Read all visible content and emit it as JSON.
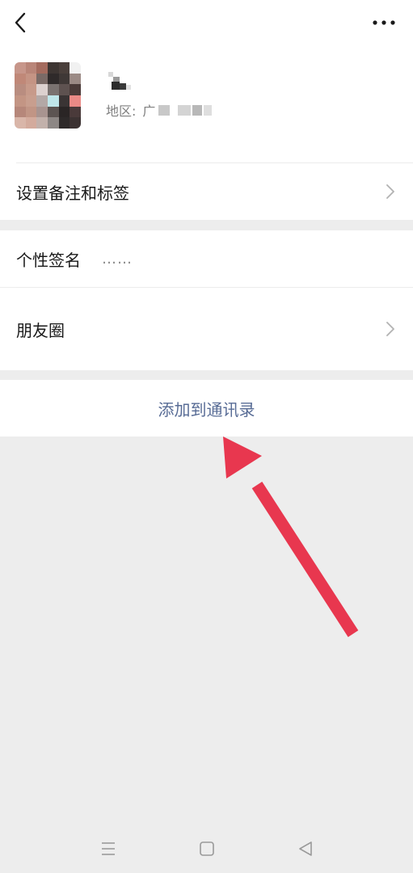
{
  "profile": {
    "region_label": "地区:",
    "region_value": "广"
  },
  "menu": {
    "remark_tags": "设置备注和标签",
    "signature_label": "个性签名",
    "signature_value": "……",
    "moments": "朋友圈"
  },
  "actions": {
    "add_to_contacts": "添加到通讯录"
  },
  "icons": {
    "back": "chevron-left-icon",
    "more": "more-dots-icon",
    "row_arrow": "chevron-right-icon",
    "nav_menu": "menu-lines-icon",
    "nav_home": "square-icon",
    "nav_back": "triangle-back-icon"
  },
  "colors": {
    "link_blue": "#576b95",
    "annotation_red": "#e8374f",
    "background": "#ededed"
  }
}
